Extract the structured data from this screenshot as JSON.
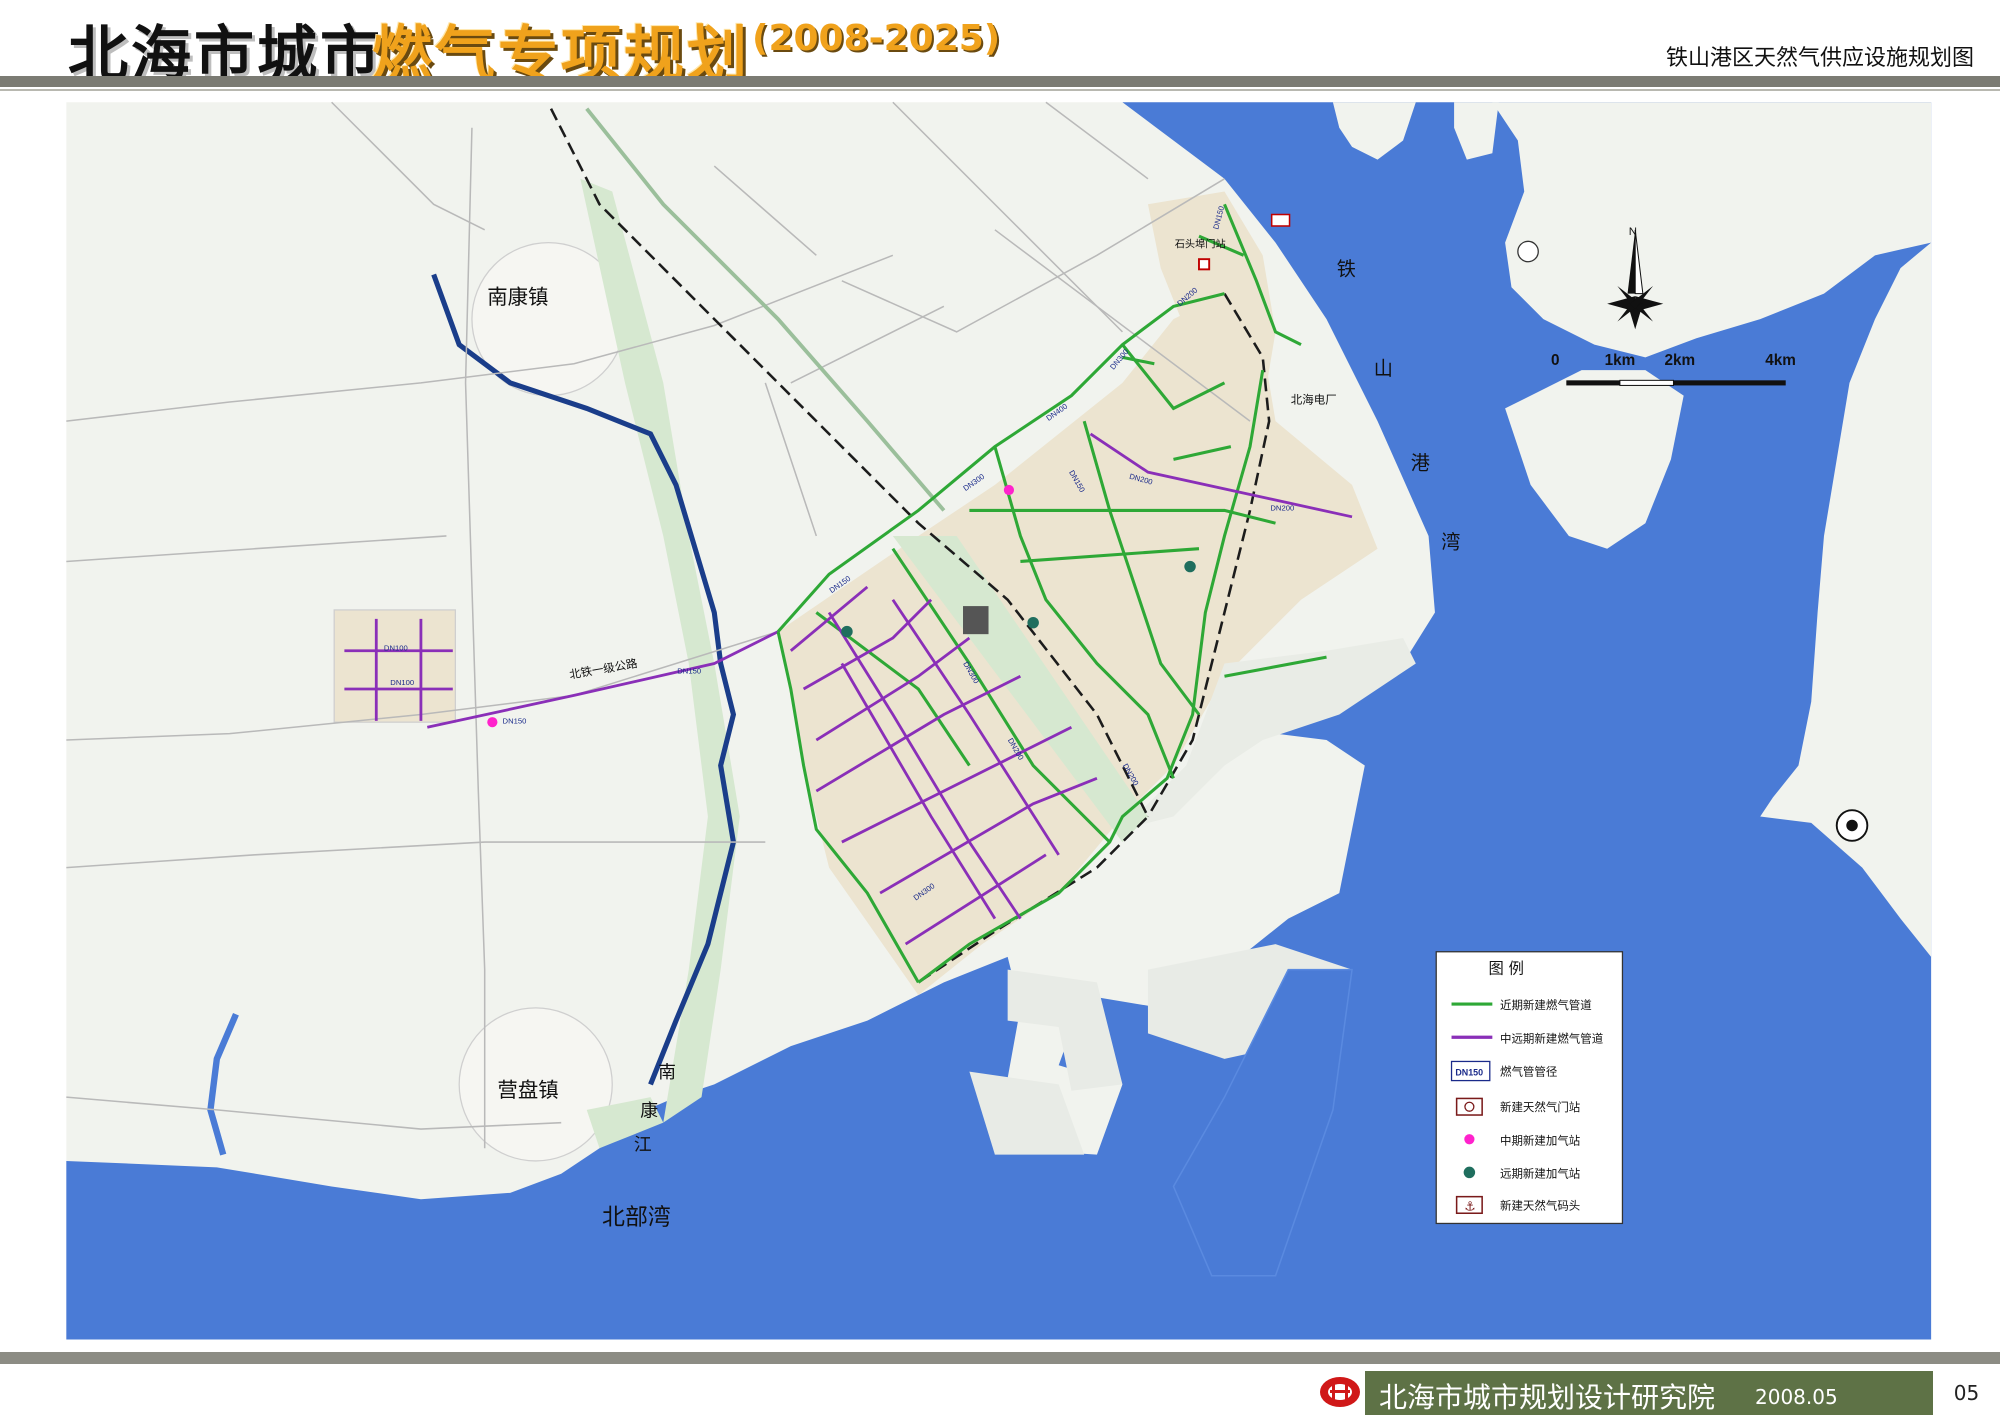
{
  "header": {
    "title_black": "北海市城市",
    "title_orange": "燃气专项规划",
    "title_years": "(2008-2025)",
    "sheet_title": "铁山港区天然气供应设施规划图"
  },
  "map_labels": {
    "nankang_town": "南康镇",
    "yingpan_town": "营盘镇",
    "beibu_gulf": "北部湾",
    "nankang_river": [
      "南",
      "康",
      "江"
    ],
    "tieshan_bay": [
      "铁",
      "山",
      "港",
      "湾"
    ],
    "beitie_road": "北铁一级公路",
    "shitoubu_station": "石头埠门站",
    "beihai_power_plant": "北海电厂",
    "compass_n": "N"
  },
  "pipe_labels": [
    "DN150",
    "DN100",
    "DN100",
    "DN150",
    "DN150",
    "DN200",
    "DN300",
    "DN400",
    "DN300",
    "DN200",
    "DN200",
    "DN150",
    "DN150",
    "DN200",
    "DN300",
    "DN200",
    "DN300"
  ],
  "scale_bar": {
    "labels": [
      "0",
      "1km",
      "2km",
      "4km"
    ]
  },
  "legend": {
    "title": "图 例",
    "items": [
      {
        "label": "近期新建燃气管道",
        "icon": "green-line"
      },
      {
        "label": "中远期新建燃气管道",
        "icon": "purple-line"
      },
      {
        "label": "燃气管管径",
        "icon": "diameter-tag",
        "tag": "DN150"
      },
      {
        "label": "新建天然气门站",
        "icon": "gate-station"
      },
      {
        "label": "中期新建加气站",
        "icon": "magenta-dot"
      },
      {
        "label": "远期新建加气站",
        "icon": "teal-dot"
      },
      {
        "label": "新建天然气码头",
        "icon": "anchor"
      }
    ]
  },
  "footer": {
    "institute": "北海市城市规划设计研究院",
    "date": "2008.05",
    "page_number": "05"
  },
  "colors": {
    "sea": "#4a7bd6",
    "land": "#f1f3ee",
    "planned_area": "#ece4d0",
    "near_term_pipe": "#2ea836",
    "long_term_pipe": "#8a2fb8",
    "magenta_station": "#ff22cc",
    "teal_station": "#1f6e5e",
    "footer_green": "#5e7246",
    "title_orange": "#f0a21c"
  }
}
